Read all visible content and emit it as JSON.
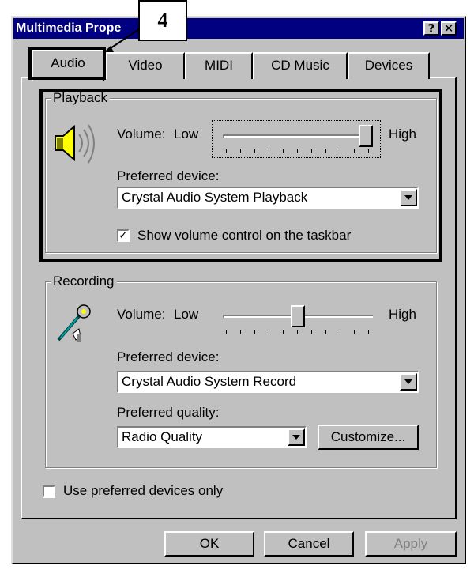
{
  "window": {
    "title": "Multimedia Prope",
    "help_button": "?",
    "close_button": "✕"
  },
  "callout": {
    "number": "4"
  },
  "tabs": [
    {
      "label": "Audio",
      "selected": true
    },
    {
      "label": "Video"
    },
    {
      "label": "MIDI"
    },
    {
      "label": "CD Music"
    },
    {
      "label": "Devices"
    }
  ],
  "playback": {
    "group_label": "Playback",
    "volume_label": "Volume:",
    "low_label": "Low",
    "high_label": "High",
    "volume_level": 1.0,
    "preferred_device_label": "Preferred device:",
    "device_value": "Crystal Audio System Playback",
    "show_volume_control_label": "Show volume control on the taskbar",
    "show_volume_control_checked": true
  },
  "recording": {
    "group_label": "Recording",
    "volume_label": "Volume:",
    "low_label": "Low",
    "high_label": "High",
    "volume_level": 0.5,
    "preferred_device_label": "Preferred device:",
    "device_value": "Crystal Audio System Record",
    "preferred_quality_label": "Preferred quality:",
    "quality_value": "Radio Quality",
    "customize_label": "Customize..."
  },
  "use_preferred_devices": {
    "label": "Use preferred devices only",
    "checked": false
  },
  "buttons": {
    "ok": "OK",
    "cancel": "Cancel",
    "apply": "Apply"
  },
  "colors": {
    "titlebar": "#000080",
    "face": "#c0c0c0",
    "highlight_box": "#000000",
    "disabled_text": "#808080"
  }
}
